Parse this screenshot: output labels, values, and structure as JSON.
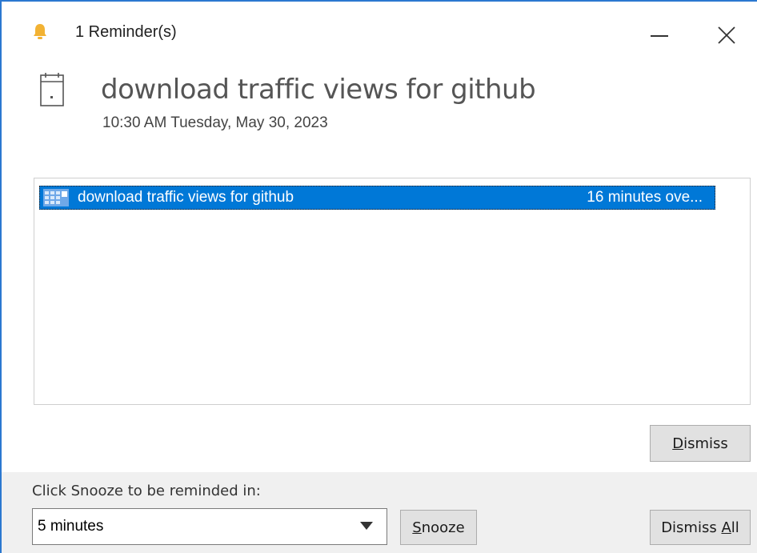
{
  "window": {
    "title": "1 Reminder(s)",
    "icons": {
      "bell": "bell-icon",
      "minimize": "minimize-icon",
      "close": "close-icon"
    }
  },
  "header": {
    "subject": "download traffic views for github",
    "time": "10:30 AM Tuesday, May 30, 2023",
    "icon": "calendar-icon"
  },
  "reminders": {
    "rows": [
      {
        "subject": "download traffic views for github",
        "due_in": "16 minutes ove...",
        "icon": "appointment-icon",
        "selected": true
      }
    ],
    "selection_color": "#0078d7"
  },
  "actions": {
    "dismiss_prefix": "",
    "dismiss_access": "D",
    "dismiss_suffix": "ismiss",
    "dismiss_all_prefix": "Dismiss ",
    "dismiss_all_access": "A",
    "dismiss_all_suffix": "ll",
    "snooze_prefix": "",
    "snooze_access": "S",
    "snooze_suffix": "nooze"
  },
  "snooze": {
    "label": "Click Snooze to be reminded in:",
    "selected": "5 minutes"
  },
  "colors": {
    "accent": "#0078d7",
    "bell": "#f2b233",
    "bottom_panel": "#f0f0f0"
  }
}
